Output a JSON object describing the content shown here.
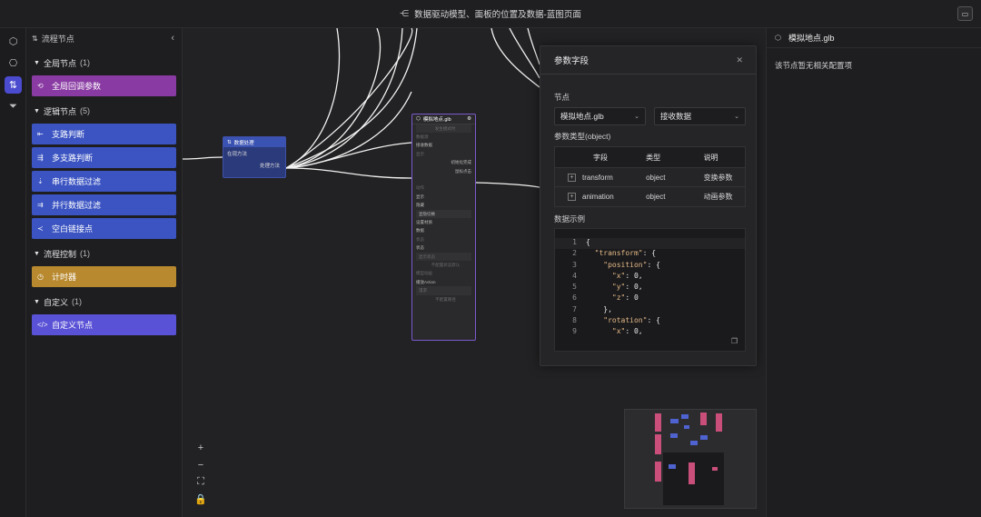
{
  "header": {
    "title": "数据驱动模型、面板的位置及数据-蓝图页面",
    "title_icon": "share-icon",
    "present_icon": "present-icon"
  },
  "rail": {
    "items": [
      {
        "icon": "cube-icon"
      },
      {
        "icon": "hexagon-icon"
      },
      {
        "icon": "flow-icon",
        "active": true
      },
      {
        "icon": "filter-icon"
      }
    ]
  },
  "left_panel": {
    "title": "流程节点",
    "groups": [
      {
        "label": "全局节点",
        "count": "(1)",
        "items": [
          {
            "label": "全局回调参数",
            "color": "#8a3ba3",
            "icon": "⟲"
          }
        ]
      },
      {
        "label": "逻辑节点",
        "count": "(5)",
        "items": [
          {
            "label": "支路判断",
            "color": "#3b54c2",
            "icon": "⇤"
          },
          {
            "label": "多支路判断",
            "color": "#3b54c2",
            "icon": "⇶"
          },
          {
            "label": "串行数据过滤",
            "color": "#3b54c2",
            "icon": "⇣"
          },
          {
            "label": "并行数据过滤",
            "color": "#3b54c2",
            "icon": "⇉"
          },
          {
            "label": "空白链接点",
            "color": "#3b54c2",
            "icon": "≺"
          }
        ]
      },
      {
        "label": "流程控制",
        "count": "(1)",
        "items": [
          {
            "label": "计时器",
            "color": "#b8892e",
            "icon": "◷"
          }
        ]
      },
      {
        "label": "自定义",
        "count": "(1)",
        "items": [
          {
            "label": "自定义节点",
            "color": "#5a52d6",
            "icon": "</>"
          }
        ]
      }
    ]
  },
  "canvas": {
    "node_data": {
      "title": "数据处理",
      "input": "在现方法",
      "output": "处理方法"
    },
    "node_model": {
      "title": "模拟地点.glb",
      "rows": [
        {
          "text": "发生模式时",
          "style": "dim box center"
        },
        {
          "text": "数据源",
          "style": "dim"
        },
        {
          "text": "接收数据",
          "style": ""
        },
        {
          "text": "显示",
          "style": "dim"
        },
        {
          "text": "初始化完成",
          "style": "right"
        },
        {
          "text": "鼠标点击",
          "style": "right"
        },
        {
          "text": "",
          "style": ""
        },
        {
          "text": "动作",
          "style": "dim"
        },
        {
          "text": "显示",
          "style": ""
        },
        {
          "text": "隐藏",
          "style": ""
        },
        {
          "text": "显隐切换",
          "style": "box"
        },
        {
          "text": "设置材质",
          "style": ""
        },
        {
          "text": "数据",
          "style": ""
        },
        {
          "text": "状态",
          "style": "dim"
        },
        {
          "text": "状态",
          "style": ""
        },
        {
          "text": "显示状态",
          "style": "dim box"
        },
        {
          "text": "不配置状态默认",
          "style": "dim center"
        },
        {
          "text": "模型动画",
          "style": "dim"
        },
        {
          "text": "播放Action",
          "style": ""
        },
        {
          "text": "漫游",
          "style": "dim box"
        },
        {
          "text": "不配置路径",
          "style": "dim center"
        }
      ]
    },
    "controls": [
      {
        "icon": "zoom-in-icon",
        "glyph": "+"
      },
      {
        "icon": "zoom-out-icon",
        "glyph": "−"
      },
      {
        "icon": "fit-view-icon",
        "glyph": "⛶"
      },
      {
        "icon": "lock-icon",
        "glyph": "🔒"
      }
    ]
  },
  "popup": {
    "title": "参数字段",
    "node_label": "节点",
    "node_select": "模拟地点.glb",
    "event_select": "接收数据",
    "param_type_label": "参数类型(object)",
    "table": {
      "headers": [
        "字段",
        "类型",
        "说明"
      ],
      "rows": [
        {
          "field": "transform",
          "type": "object",
          "desc": "变换参数"
        },
        {
          "field": "animation",
          "type": "object",
          "desc": "动画参数"
        }
      ]
    },
    "example_label": "数据示例",
    "code_lines": [
      {
        "n": "1",
        "text": "{"
      },
      {
        "n": "2",
        "text": "  \"transform\": {"
      },
      {
        "n": "3",
        "text": "    \"position\": {"
      },
      {
        "n": "4",
        "text": "      \"x\": 0,"
      },
      {
        "n": "5",
        "text": "      \"y\": 0,"
      },
      {
        "n": "6",
        "text": "      \"z\": 0"
      },
      {
        "n": "7",
        "text": "    },"
      },
      {
        "n": "8",
        "text": "    \"rotation\": {"
      },
      {
        "n": "9",
        "text": "      \"x\": 0,"
      }
    ]
  },
  "right_panel": {
    "title": "模拟地点.glb",
    "icon": "cube-icon",
    "empty_text": "该节点暂无相关配置项"
  }
}
